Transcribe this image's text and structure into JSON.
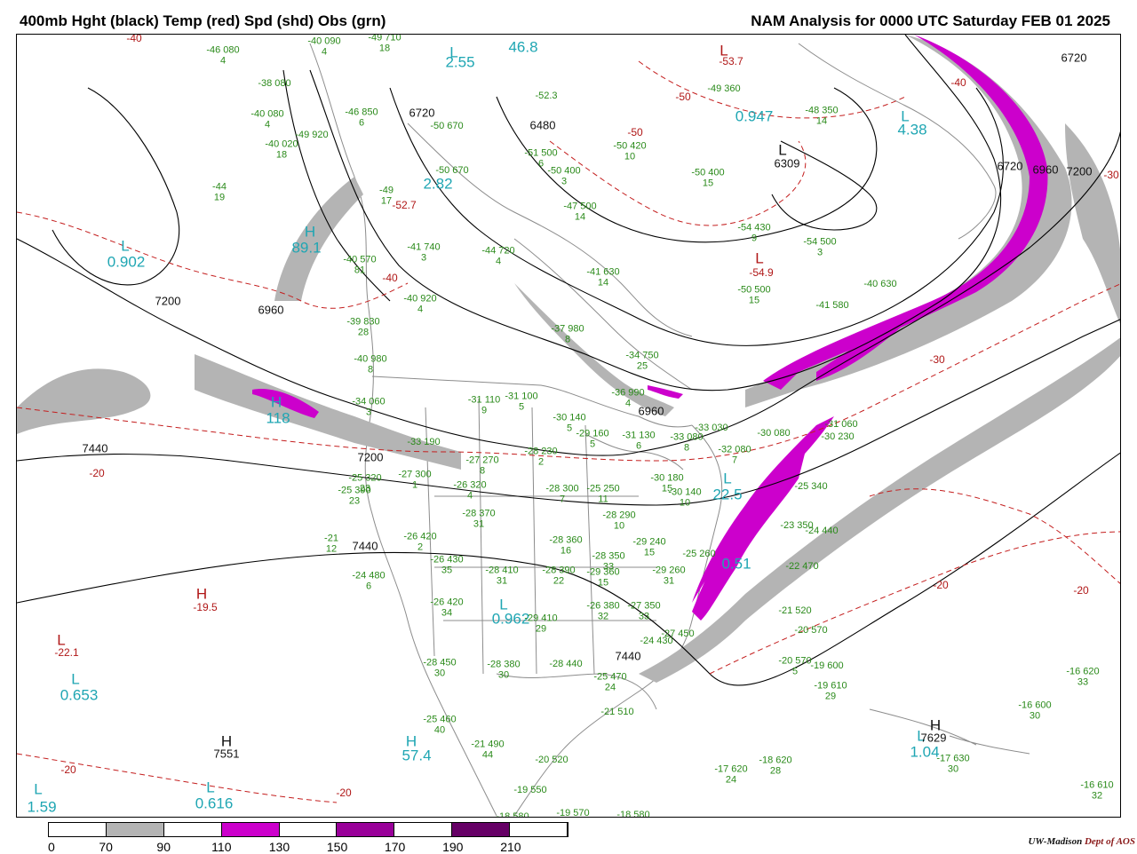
{
  "title_left": "400mb Hght (black) Temp (red) Spd (shd) Obs (grn)",
  "title_right": "NAM Analysis for 0000 UTC Saturday  FEB 01 2025",
  "colors": {
    "height_contour": "#000000",
    "temp_contour": "#c41e1e",
    "obs_text": "#2a8a1a",
    "cyan_label": "#1fa6b3",
    "speed_70_90": "#b4b4b4",
    "speed_110_130": "#cc00cc",
    "speed_150_170": "#990099",
    "speed_190_210": "#660066",
    "geography": "#8c8c8c"
  },
  "pressure_centers": [
    {
      "type": "L",
      "value": "2.55",
      "color": "cyan"
    },
    {
      "type": "L",
      "value": "46.8",
      "color": "cyan"
    },
    {
      "type": "L",
      "value": "0.947",
      "color": "cyan"
    },
    {
      "type": "L",
      "value": "4.38",
      "color": "cyan"
    },
    {
      "type": "L",
      "value": "6309",
      "color": "dark"
    },
    {
      "type": "L",
      "value": "0.902",
      "color": "cyan"
    },
    {
      "type": "H",
      "value": "89.1",
      "color": "cyan"
    },
    {
      "type": "H",
      "value": "118",
      "color": "cyan"
    },
    {
      "type": "L",
      "value": "2.82",
      "color": "cyan"
    },
    {
      "type": "H",
      "value": "-19.5",
      "color": "red"
    },
    {
      "type": "L",
      "value": "-22.1",
      "color": "red"
    },
    {
      "type": "L",
      "value": "0.653",
      "color": "cyan"
    },
    {
      "type": "H",
      "value": "7551",
      "color": "dark"
    },
    {
      "type": "H",
      "value": "57.4",
      "color": "cyan"
    },
    {
      "type": "L",
      "value": "1.59",
      "color": "cyan"
    },
    {
      "type": "L",
      "value": "0.616",
      "color": "cyan"
    },
    {
      "type": "L",
      "value": "1.04",
      "color": "cyan"
    },
    {
      "type": "H",
      "value": "7629",
      "color": "dark"
    },
    {
      "type": "L",
      "value": "0.962",
      "color": "cyan"
    },
    {
      "type": "L",
      "value": "-54.9",
      "color": "red"
    },
    {
      "type": "L",
      "value": "-53.7",
      "color": "red"
    },
    {
      "type": "L",
      "value": "22.5",
      "color": "cyan"
    },
    {
      "type": "L",
      "value": "0.51",
      "color": "cyan"
    }
  ],
  "height_labels": [
    "6720",
    "6480",
    "7200",
    "6960",
    "7440",
    "7200",
    "7440",
    "7440",
    "6960",
    "6720",
    "6720",
    "6960",
    "7200"
  ],
  "temp_labels": [
    "-40",
    "-50",
    "-50",
    "-30",
    "-20",
    "-20",
    "-20",
    "-20",
    "-20",
    "-40",
    "-52.7",
    "-40",
    "-30"
  ],
  "obs": [
    {
      "t": "-46",
      "h": "080",
      "s": "4"
    },
    {
      "t": "-40",
      "h": "090",
      "s": "4"
    },
    {
      "t": "-49",
      "h": "710",
      "s": "18"
    },
    {
      "t": "-38",
      "h": "080",
      "s": ""
    },
    {
      "t": "-46",
      "h": "850",
      "s": "6"
    },
    {
      "t": "-40",
      "h": "080",
      "s": "4"
    },
    {
      "t": "-49",
      "h": "920",
      "s": ""
    },
    {
      "t": "-40",
      "h": "020",
      "s": "18"
    },
    {
      "t": "-50",
      "h": "670",
      "s": ""
    },
    {
      "t": "-51",
      "h": "500",
      "s": "6"
    },
    {
      "t": "-50",
      "h": "420",
      "s": "10"
    },
    {
      "t": "-49",
      "h": "360",
      "s": ""
    },
    {
      "t": "-48",
      "h": "350",
      "s": "14"
    },
    {
      "t": "-50",
      "h": "400",
      "s": "15"
    },
    {
      "t": "-52.3",
      "h": "",
      "s": ""
    },
    {
      "t": "-50",
      "h": "670",
      "s": ""
    },
    {
      "t": "-50",
      "h": "400",
      "s": "3"
    },
    {
      "t": "-44",
      "h": "",
      "s": "19"
    },
    {
      "t": "-49",
      "h": "",
      "s": "17"
    },
    {
      "t": "-47",
      "h": "500",
      "s": "14"
    },
    {
      "t": "-54",
      "h": "430",
      "s": "9"
    },
    {
      "t": "-54",
      "h": "500",
      "s": "3"
    },
    {
      "t": "-41",
      "h": "740",
      "s": "3"
    },
    {
      "t": "-44",
      "h": "720",
      "s": "4"
    },
    {
      "t": "-40",
      "h": "570",
      "s": "81"
    },
    {
      "t": "-41",
      "h": "630",
      "s": "14"
    },
    {
      "t": "-50",
      "h": "500",
      "s": "15"
    },
    {
      "t": "-41",
      "h": "580",
      "s": ""
    },
    {
      "t": "-40",
      "h": "630",
      "s": ""
    },
    {
      "t": "-39",
      "h": "830",
      "s": "28"
    },
    {
      "t": "-40",
      "h": "920",
      "s": "4"
    },
    {
      "t": "-37",
      "h": "980",
      "s": "8"
    },
    {
      "t": "-40",
      "h": "980",
      "s": "8"
    },
    {
      "t": "-34",
      "h": "750",
      "s": "25"
    },
    {
      "t": "-36",
      "h": "990",
      "s": "4"
    },
    {
      "t": "-34",
      "h": "060",
      "s": "3"
    },
    {
      "t": "-31",
      "h": "110",
      "s": "9"
    },
    {
      "t": "-31",
      "h": "100",
      "s": "5"
    },
    {
      "t": "-30",
      "h": "140",
      "s": "5"
    },
    {
      "t": "-33",
      "h": "190",
      "s": ""
    },
    {
      "t": "-29",
      "h": "160",
      "s": "5"
    },
    {
      "t": "-31",
      "h": "130",
      "s": "6"
    },
    {
      "t": "-33",
      "h": "080",
      "s": "8"
    },
    {
      "t": "-33",
      "h": "030",
      "s": ""
    },
    {
      "t": "-32",
      "h": "080",
      "s": "7"
    },
    {
      "t": "-30",
      "h": "080",
      "s": ""
    },
    {
      "t": "-31",
      "h": "060",
      "s": ""
    },
    {
      "t": "-30",
      "h": "230",
      "s": ""
    },
    {
      "t": "-27",
      "h": "270",
      "s": "8"
    },
    {
      "t": "-28",
      "h": "230",
      "s": "2"
    },
    {
      "t": "-25",
      "h": "320",
      "s": "23"
    },
    {
      "t": "-27",
      "h": "300",
      "s": "1"
    },
    {
      "t": "-26",
      "h": "320",
      "s": "4"
    },
    {
      "t": "-28",
      "h": "300",
      "s": "7"
    },
    {
      "t": "-25",
      "h": "250",
      "s": "11"
    },
    {
      "t": "-30",
      "h": "180",
      "s": "15"
    },
    {
      "t": "-30",
      "h": "140",
      "s": "10"
    },
    {
      "t": "-25",
      "h": "390",
      "s": "23"
    },
    {
      "t": "-28",
      "h": "370",
      "s": "31"
    },
    {
      "t": "-28",
      "h": "290",
      "s": "10"
    },
    {
      "t": "-25",
      "h": "260",
      "s": ""
    },
    {
      "t": "-25",
      "h": "340",
      "s": ""
    },
    {
      "t": "-23",
      "h": "350",
      "s": ""
    },
    {
      "t": "-24",
      "h": "440",
      "s": ""
    },
    {
      "t": "-21",
      "h": "",
      "s": "12"
    },
    {
      "t": "-26",
      "h": "420",
      "s": "2"
    },
    {
      "t": "-26",
      "h": "430",
      "s": "35"
    },
    {
      "t": "-28",
      "h": "360",
      "s": "16"
    },
    {
      "t": "-29",
      "h": "240",
      "s": "15"
    },
    {
      "t": "-28",
      "h": "350",
      "s": "33"
    },
    {
      "t": "-24",
      "h": "480",
      "s": "6"
    },
    {
      "t": "-28",
      "h": "410",
      "s": "31"
    },
    {
      "t": "-28",
      "h": "390",
      "s": "22"
    },
    {
      "t": "-29",
      "h": "360",
      "s": "15"
    },
    {
      "t": "-29",
      "h": "260",
      "s": "31"
    },
    {
      "t": "-22",
      "h": "470",
      "s": ""
    },
    {
      "t": "-26",
      "h": "420",
      "s": "34"
    },
    {
      "t": "-29",
      "h": "410",
      "s": "29"
    },
    {
      "t": "-26",
      "h": "380",
      "s": "32"
    },
    {
      "t": "-27",
      "h": "350",
      "s": "33"
    },
    {
      "t": "-21",
      "h": "520",
      "s": ""
    },
    {
      "t": "-24",
      "h": "430",
      "s": ""
    },
    {
      "t": "-27",
      "h": "450",
      "s": ""
    },
    {
      "t": "-20",
      "h": "570",
      "s": ""
    },
    {
      "t": "-28",
      "h": "450",
      "s": "30"
    },
    {
      "t": "-28",
      "h": "380",
      "s": "30"
    },
    {
      "t": "-28",
      "h": "440",
      "s": ""
    },
    {
      "t": "-25",
      "h": "470",
      "s": "24"
    },
    {
      "t": "-20",
      "h": "570",
      "s": "5"
    },
    {
      "t": "-19",
      "h": "600",
      "s": ""
    },
    {
      "t": "-19",
      "h": "610",
      "s": "29"
    },
    {
      "t": "-21",
      "h": "510",
      "s": ""
    },
    {
      "t": "-25",
      "h": "460",
      "s": "40"
    },
    {
      "t": "-21",
      "h": "490",
      "s": "44"
    },
    {
      "t": "-20",
      "h": "520",
      "s": ""
    },
    {
      "t": "-16",
      "h": "620",
      "s": "33"
    },
    {
      "t": "-16",
      "h": "600",
      "s": "30"
    },
    {
      "t": "-17",
      "h": "630",
      "s": "30"
    },
    {
      "t": "-17",
      "h": "620",
      "s": "24"
    },
    {
      "t": "-18",
      "h": "620",
      "s": "28"
    },
    {
      "t": "-19",
      "h": "550",
      "s": ""
    },
    {
      "t": "-18",
      "h": "580",
      "s": ""
    },
    {
      "t": "-19",
      "h": "570",
      "s": ""
    },
    {
      "t": "-18",
      "h": "580",
      "s": ""
    },
    {
      "t": "-16",
      "h": "610",
      "s": "32"
    }
  ],
  "colorbar": {
    "ticks": [
      "0",
      "70",
      "90",
      "110",
      "130",
      "150",
      "170",
      "190",
      "210"
    ],
    "segments": [
      "#ffffff",
      "#b4b4b4",
      "#ffffff",
      "#cc00cc",
      "#ffffff",
      "#990099",
      "#ffffff",
      "#660066",
      "#ffffff"
    ]
  },
  "credit": {
    "org": "UW-Madison",
    "dept": "Dept of AOS"
  }
}
